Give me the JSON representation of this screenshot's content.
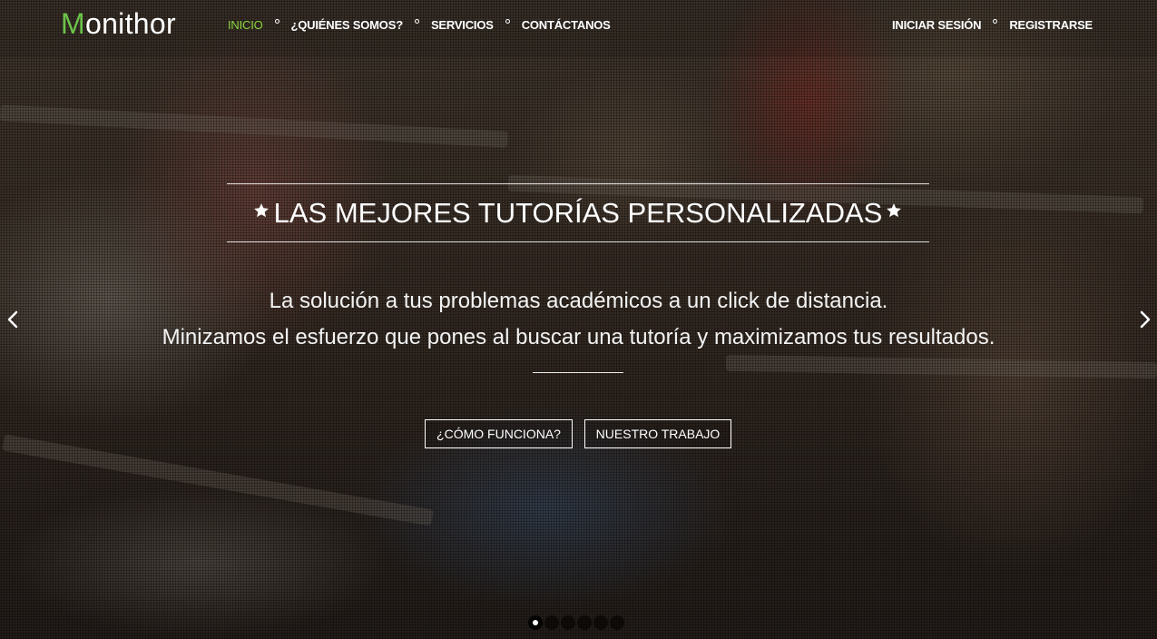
{
  "brand": {
    "logo_initial": "M",
    "logo_rest": "onithor",
    "accent_color": "#6cc24a"
  },
  "nav": {
    "main": [
      {
        "label": "INICIO",
        "active": true
      },
      {
        "label": "¿QUIÉNES SOMOS?",
        "active": false
      },
      {
        "label": "SERVICIOS",
        "active": false
      },
      {
        "label": "CONTÁCTANOS",
        "active": false
      }
    ],
    "auth": [
      {
        "label": "INICIAR SESIÓN"
      },
      {
        "label": "REGISTRARSE"
      }
    ]
  },
  "hero": {
    "headline": "LAS MEJORES TUTORÍAS PERSONALIZADAS",
    "subline_1": "La solución a tus problemas académicos a un click de distancia.",
    "subline_2": "Minizamos el esfuerzo que pones al buscar una tutoría y maximizamos tus resultados.",
    "buttons": {
      "how_it_works": "¿CÓMO FUNCIONA?",
      "our_work": "NUESTRO TRABAJO"
    },
    "decor_icons": [
      "star-icon",
      "star-icon"
    ]
  },
  "carousel": {
    "prev_icon": "chevron-left-icon",
    "next_icon": "chevron-right-icon",
    "slide_count": 6,
    "active_index": 0
  }
}
